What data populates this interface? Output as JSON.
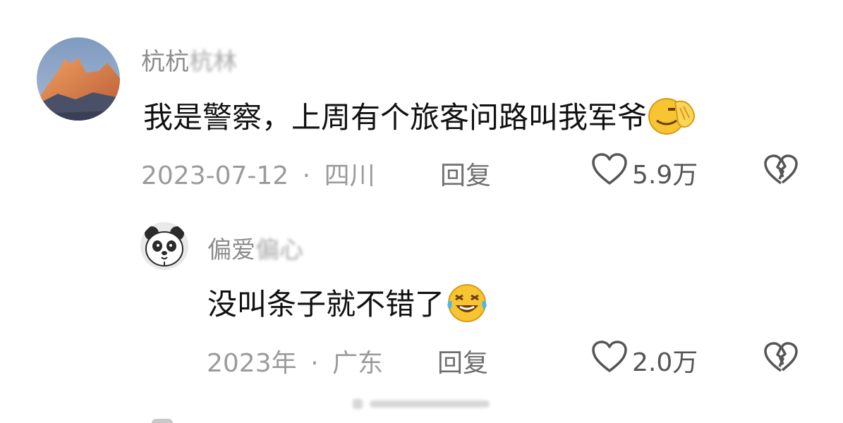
{
  "comments": [
    {
      "username_visible": "杭杭",
      "username_blurred": "杭林",
      "text": "我是警察，上周有个旅客问路叫我军爷",
      "emoji": "face-palm-emoji",
      "date": "2023-07-12",
      "separator": "·",
      "location": "四川",
      "reply_label": "回复",
      "likes": "5.9万"
    },
    {
      "username_visible": "偏爱",
      "username_blurred": "偏心",
      "text": "没叫条子就不错了",
      "emoji": "rolling-laughing-emoji",
      "date": "2023年",
      "separator": "·",
      "location": "广东",
      "reply_label": "回复",
      "likes": "2.0万"
    }
  ],
  "colors": {
    "username": "#8c8c8c",
    "text": "#111111",
    "meta": "#9b9b9b",
    "icon": "#555555",
    "emoji_yellow": "#f7c531"
  }
}
